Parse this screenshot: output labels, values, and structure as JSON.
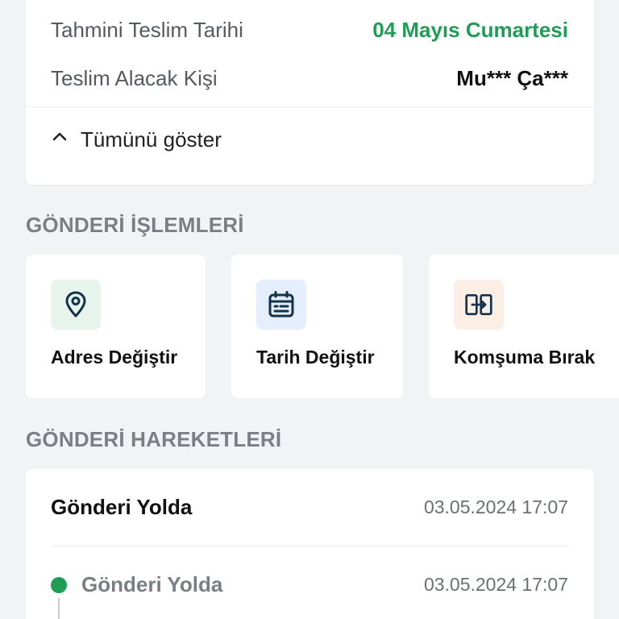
{
  "summary": {
    "estimated_delivery_label": "Tahmini Teslim Tarihi",
    "estimated_delivery_value": "04 Mayıs Cumartesi",
    "receiver_label": "Teslim Alacak Kişi",
    "receiver_value": "Mu*** Ça***",
    "show_all_label": "Tümünü göster",
    "show_all_icon": "chevron-up-icon"
  },
  "operations": {
    "title": "GÖNDERİ İŞLEMLERİ",
    "actions": [
      {
        "label": "Adres Değiştir",
        "icon": "location-pin-icon",
        "icon_bg": "#e6f4ec"
      },
      {
        "label": "Tarih Değiştir",
        "icon": "calendar-icon",
        "icon_bg": "#e5eefc"
      },
      {
        "label": "Komşuma Bırak",
        "icon": "neighbor-transfer-icon",
        "icon_bg": "#fbefe5"
      }
    ]
  },
  "movements": {
    "title": "GÖNDERİ HAREKETLERİ",
    "current": {
      "status": "Gönderi Yolda",
      "datetime": "03.05.2024 17:07"
    },
    "timeline": [
      {
        "status": "Gönderi Yolda",
        "datetime": "03.05.2024 17:07"
      }
    ]
  },
  "colors": {
    "accent_green": "#1f9d55",
    "icon_dark": "#13324b",
    "background": "#f2f3f5"
  }
}
